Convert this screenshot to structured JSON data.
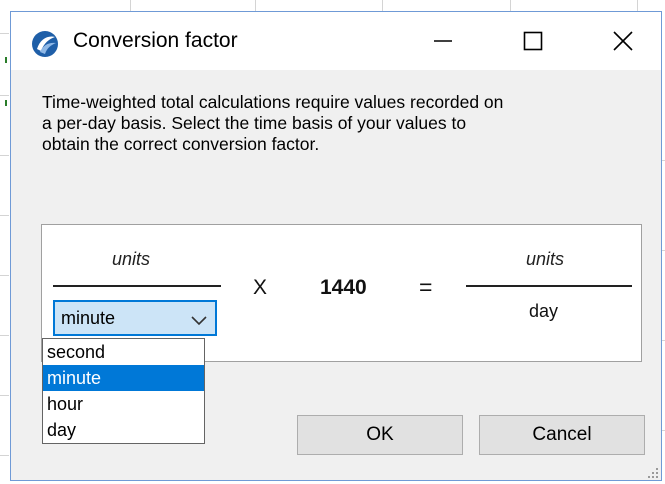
{
  "dialog": {
    "title": "Conversion factor",
    "app_icon": "app-logo-icon",
    "controls": {
      "minimize": "minimize-icon",
      "maximize": "maximize-icon",
      "close": "close-icon"
    }
  },
  "description": "Time-weighted total calculations require values recorded on\na per-day basis. Select the time basis of your values to\nobtain the correct conversion factor.",
  "formula": {
    "numerator_left": "units",
    "operator_times": "X",
    "factor": "1440",
    "operator_equals": "=",
    "numerator_right": "units",
    "denominator_right": "day"
  },
  "time_basis": {
    "selected": "minute",
    "options": [
      "second",
      "minute",
      "hour",
      "day"
    ],
    "highlighted_index": 1
  },
  "buttons": {
    "ok": "OK",
    "cancel": "Cancel"
  },
  "colors": {
    "accent": "#0078d7",
    "select_bg": "#cce4f7",
    "dialog_bg": "#f0f0f0",
    "button_bg": "#e1e1e1"
  }
}
